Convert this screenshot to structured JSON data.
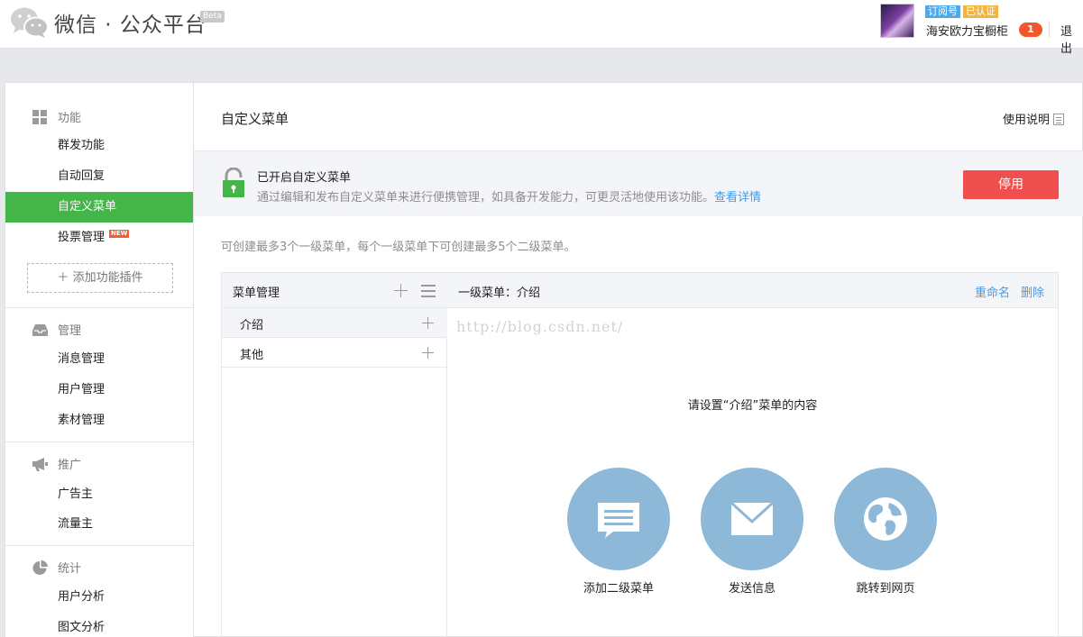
{
  "header": {
    "brand": "微信 · 公众平台",
    "beta": "Beta",
    "tag_subscribe": "订阅号",
    "tag_verified": "已认证",
    "account_name": "海安欧力宝橱柜",
    "notification_count": "1",
    "logout": "退出"
  },
  "sidebar": {
    "groups": [
      {
        "title": "功能",
        "icon": "grid-icon",
        "items": [
          "群发功能",
          "自动回复",
          "自定义菜单",
          "投票管理"
        ]
      },
      {
        "title": "管理",
        "icon": "inbox-icon",
        "items": [
          "消息管理",
          "用户管理",
          "素材管理"
        ]
      },
      {
        "title": "推广",
        "icon": "megaphone-icon",
        "items": [
          "广告主",
          "流量主"
        ]
      },
      {
        "title": "统计",
        "icon": "pie-chart-icon",
        "items": [
          "用户分析",
          "图文分析"
        ]
      }
    ],
    "active_item": "自定义菜单",
    "new_tag": "NEW",
    "add_plugin": "添加功能插件"
  },
  "content": {
    "title": "自定义菜单",
    "help": "使用说明",
    "notice_title": "已开启自定义菜单",
    "notice_desc": "通过编辑和发布自定义菜单来进行便携管理，如具备开发能力，可更灵活地使用该功能。",
    "notice_link": "查看详情",
    "stop_button": "停用",
    "hint": "可创建最多3个一级菜单，每个一级菜单下可创建最多5个二级菜单。"
  },
  "menu_panel": {
    "left_title": "菜单管理",
    "menus": [
      "介绍",
      "其他"
    ],
    "selected_menu": "介绍",
    "right_title": "一级菜单：介绍",
    "rename": "重命名",
    "delete": "删除",
    "watermark": "http://blog.csdn.net/",
    "prompt": "请设置“介绍”菜单的内容",
    "actions": [
      {
        "label": "添加二级菜单",
        "icon": "submenu-icon"
      },
      {
        "label": "发送信息",
        "icon": "envelope-icon"
      },
      {
        "label": "跳转到网页",
        "icon": "globe-icon"
      }
    ]
  },
  "colors": {
    "active_green": "#44b549",
    "stop_red": "#ef4f4f",
    "link_blue": "#459ae9",
    "action_circle": "#8db8d8"
  }
}
